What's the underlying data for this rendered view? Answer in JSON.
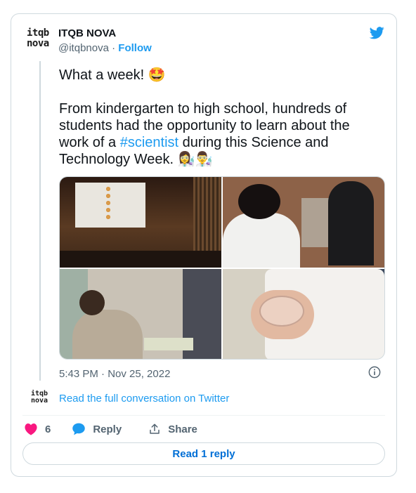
{
  "tweet": {
    "author_name": "ITQB NOVA",
    "avatar_line1": "itqb",
    "avatar_line2": "nova",
    "handle": "@itqbnova",
    "separator": "·",
    "follow_label": "Follow",
    "text_line1": "What a week! 🤩",
    "text_part1": "From kindergarten to high school, hundreds of students had the opportunity to learn about the work of a ",
    "hashtag": "#scientist",
    "text_part2": " during this Science and Technology Week. 👩‍🔬👨‍🔬",
    "timestamp": "5:43 PM · Nov 25, 2022",
    "read_full_label": "Read the full conversation on Twitter",
    "likes_count": "6",
    "reply_label": "Reply",
    "share_label": "Share",
    "read_replies_label": "Read 1 reply"
  },
  "icons": {
    "brand": "twitter-bird-icon",
    "info": "info-icon",
    "like": "heart-icon",
    "reply": "speech-bubble-icon",
    "share": "share-upload-icon"
  },
  "colors": {
    "accent": "#1d9bf0",
    "like": "#f91880",
    "text": "#0f1419",
    "secondary": "#536471",
    "border": "#cfd9de",
    "reply_button_text": "#006fd6"
  }
}
